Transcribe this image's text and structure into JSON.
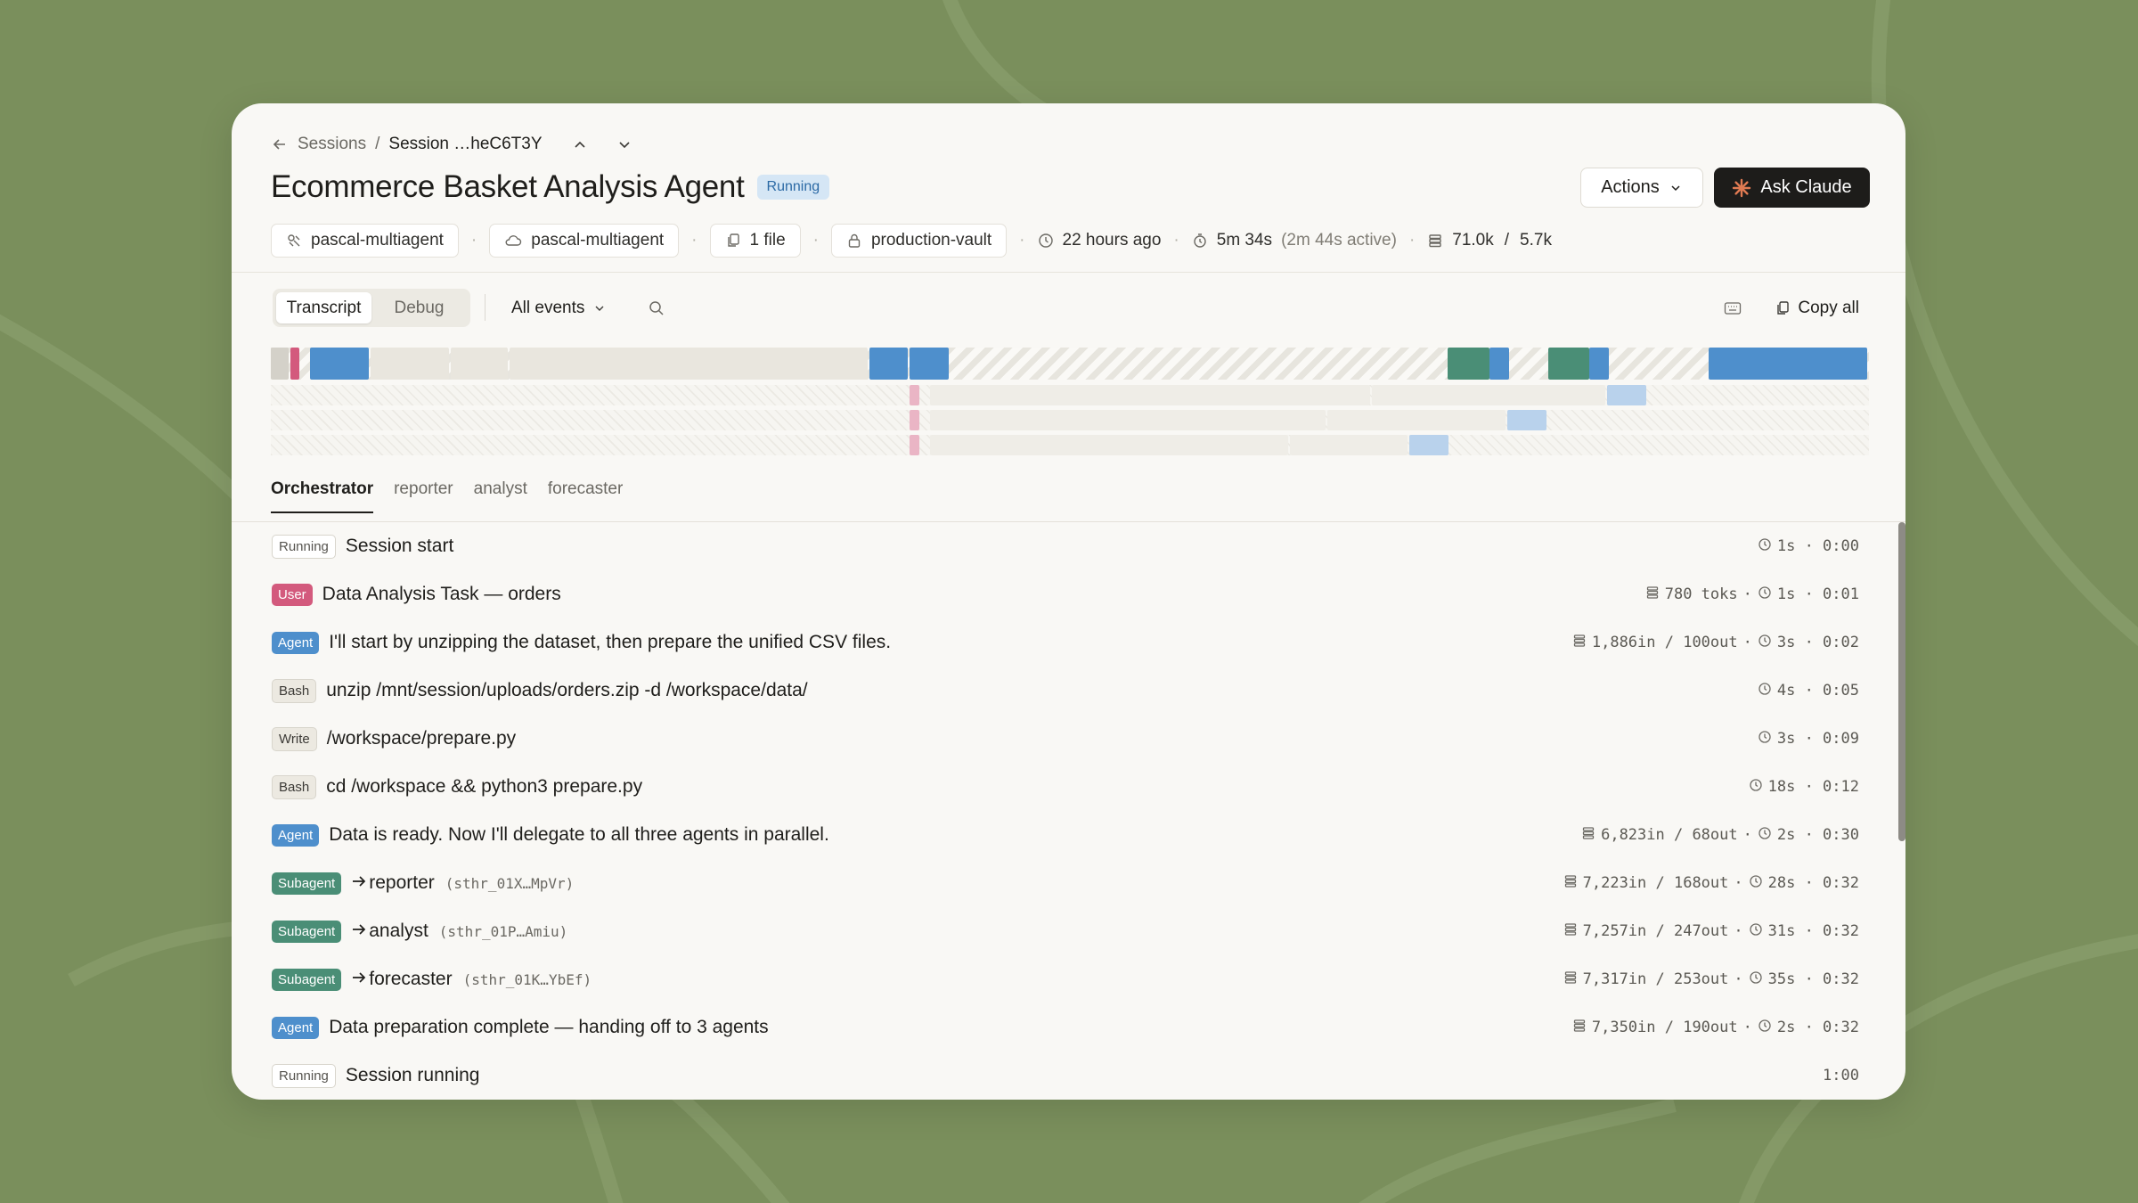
{
  "breadcrumb": {
    "parent": "Sessions",
    "separator": "/",
    "current": "Session …heC6T3Y"
  },
  "header": {
    "title": "Ecommerce Basket Analysis Agent",
    "status": "Running",
    "actions_label": "Actions",
    "ask_label": "Ask Claude"
  },
  "meta": {
    "agent": "pascal-multiagent",
    "environment": "pascal-multiagent",
    "files": "1 file",
    "vault": "production-vault",
    "created": "22 hours ago",
    "duration": "5m 34s",
    "active": "(2m 44s active)",
    "tokens_in": "71.0k",
    "tokens_sep": "/",
    "tokens_out": "5.7k"
  },
  "toolbar": {
    "tab_transcript": "Transcript",
    "tab_debug": "Debug",
    "filter": "All events",
    "copy_all": "Copy all"
  },
  "subtabs": [
    "Orchestrator",
    "reporter",
    "analyst",
    "forecaster"
  ],
  "colors": {
    "accent_blue": "#4e8fcc",
    "user_pink": "#d35a7d",
    "subagent_green": "#4a8e76",
    "running_blue": "#d5e6f5"
  },
  "events": [
    {
      "badge": "Running",
      "text": "Session start",
      "hash": "",
      "tokens": "",
      "time": "1s · 0:00"
    },
    {
      "badge": "User",
      "text": "Data Analysis Task — orders",
      "hash": "",
      "tokens": "780 toks",
      "time": "1s · 0:01"
    },
    {
      "badge": "Agent",
      "text": "I'll start by unzipping the dataset, then prepare the unified CSV files.",
      "hash": "",
      "tokens": "1,886in / 100out",
      "time": "3s · 0:02"
    },
    {
      "badge": "Bash",
      "text": "unzip /mnt/session/uploads/orders.zip -d /workspace/data/",
      "hash": "",
      "tokens": "",
      "time": "4s · 0:05"
    },
    {
      "badge": "Write",
      "text": "/workspace/prepare.py",
      "hash": "",
      "tokens": "",
      "time": "3s · 0:09"
    },
    {
      "badge": "Bash",
      "text": "cd /workspace && python3 prepare.py",
      "hash": "",
      "tokens": "",
      "time": "18s · 0:12"
    },
    {
      "badge": "Agent",
      "text": "Data is ready. Now I'll delegate to all three agents in parallel.",
      "hash": "",
      "tokens": "6,823in / 68out",
      "time": "2s · 0:30"
    },
    {
      "badge": "Subagent",
      "text": "reporter",
      "hash": "(sthr_01X…MpVr)",
      "tokens": "7,223in / 168out",
      "time": "28s · 0:32"
    },
    {
      "badge": "Subagent",
      "text": "analyst",
      "hash": "(sthr_01P…Amiu)",
      "tokens": "7,257in / 247out",
      "time": "31s · 0:32"
    },
    {
      "badge": "Subagent",
      "text": "forecaster",
      "hash": "(sthr_01K…YbEf)",
      "tokens": "7,317in / 253out",
      "time": "35s · 0:32"
    },
    {
      "badge": "Agent",
      "text": "Data preparation complete — handing off to 3 agents",
      "hash": "",
      "tokens": "7,350in / 190out",
      "time": "2s · 0:32"
    },
    {
      "badge": "Running",
      "text": "Session running",
      "hash": "",
      "tokens": "",
      "time": "1:00"
    }
  ]
}
